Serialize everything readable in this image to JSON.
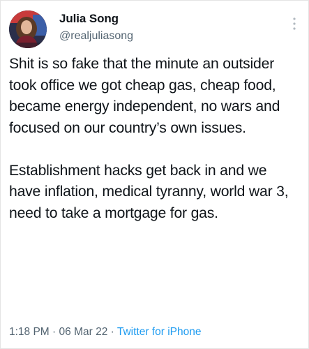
{
  "author": {
    "display_name": "Julia Song",
    "handle": "@realjuliasong"
  },
  "tweet": {
    "paragraphs": [
      "Shit is so fake that the minute an outsider took office we got cheap gas, cheap food, became energy independent, no wars and focused on our country’s own issues.",
      "Establishment hacks get back in and we have inflation, medical tyranny, world war 3, need to take a mortgage for gas."
    ],
    "time": "1:18 PM",
    "date": "06 Mar 22",
    "separator": "·",
    "source": "Twitter for iPhone"
  },
  "icons": {
    "more": "more-vertical-icon"
  },
  "colors": {
    "text_primary": "#0f1419",
    "text_secondary": "#536471",
    "link": "#1d9bf0"
  }
}
